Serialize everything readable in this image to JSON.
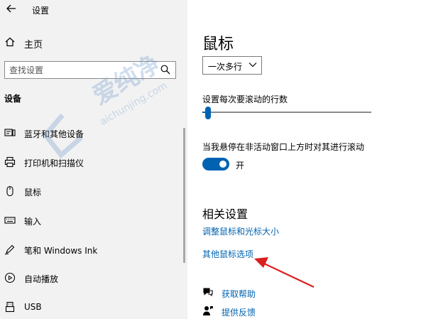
{
  "titlebar": {
    "title": "设置",
    "back_icon": "back-arrow-icon"
  },
  "sidebar": {
    "home_label": "主页",
    "search_placeholder": "查找设置",
    "section_title": "设备",
    "items": [
      {
        "label": "蓝牙和其他设备",
        "icon": "bluetooth-devices-icon"
      },
      {
        "label": "打印机和扫描仪",
        "icon": "printer-icon"
      },
      {
        "label": "鼠标",
        "icon": "mouse-icon"
      },
      {
        "label": "输入",
        "icon": "keyboard-icon"
      },
      {
        "label": "笔和 Windows Ink",
        "icon": "pen-icon"
      },
      {
        "label": "自动播放",
        "icon": "autoplay-icon"
      },
      {
        "label": "USB",
        "icon": "usb-icon"
      }
    ]
  },
  "main": {
    "page_title": "鼠标",
    "scroll_mode_value": "一次多行",
    "lines_label": "设置每次要滚动的行数",
    "lines_value": 1,
    "inactive_scroll_label": "当我悬停在非活动窗口上方时对其进行滚动",
    "inactive_scroll_state": "开",
    "related_title": "相关设置",
    "links": {
      "adjust_size": "调整鼠标和光标大小",
      "other_options": "其他鼠标选项"
    },
    "help": {
      "get_help": "获取帮助",
      "feedback": "提供反馈"
    }
  },
  "watermark": {
    "text": "爱纯净",
    "sub": "aichunjing.com"
  },
  "colors": {
    "accent": "#0063b1",
    "sidebar_bg": "#f2f2f2",
    "annotation": "#d9201e"
  }
}
